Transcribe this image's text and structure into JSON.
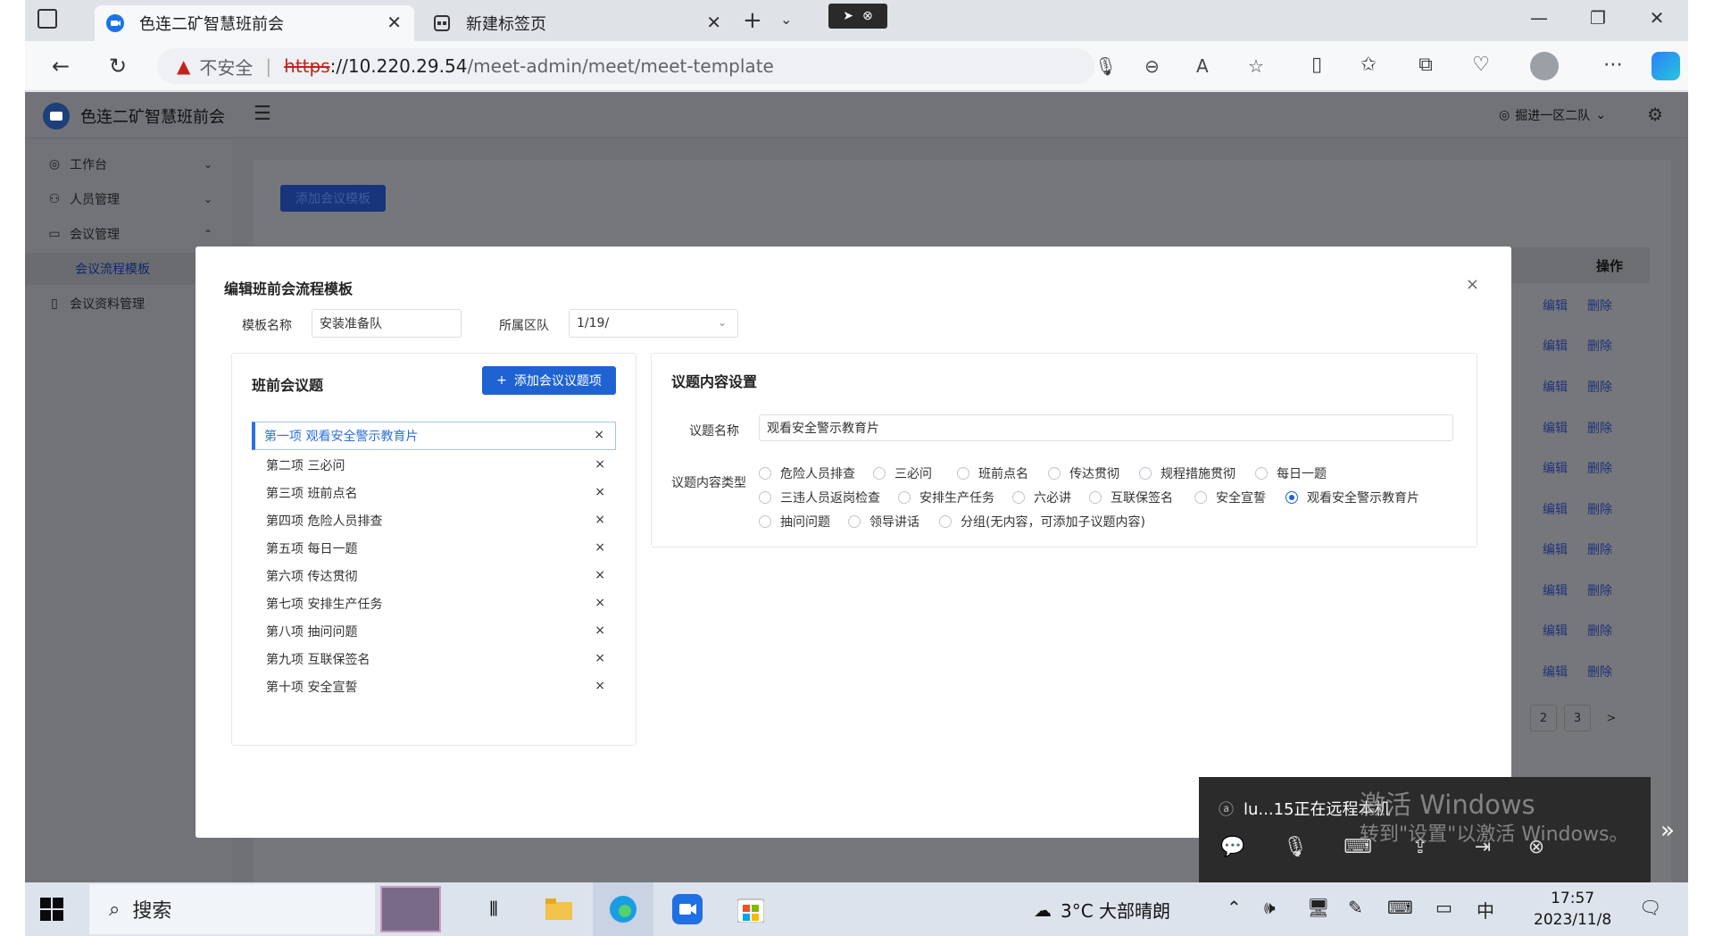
{
  "browser": {
    "tabs": [
      {
        "title": "色连二矿智慧班前会",
        "active": true
      },
      {
        "title": "新建标签页",
        "active": false
      }
    ],
    "url": {
      "insecure_label": "不安全",
      "scheme": "https",
      "host": "://10.220.29.54",
      "path": "/meet-admin/meet/meet-template"
    }
  },
  "app": {
    "title": "色连二矿智慧班前会",
    "team": "掘进一区二队",
    "sidebar": [
      {
        "label": "工作台"
      },
      {
        "label": "人员管理"
      },
      {
        "label": "会议管理"
      },
      {
        "label": "会议流程模板"
      },
      {
        "label": "会议资料管理"
      }
    ],
    "add_template_button": "添加会议模板",
    "table": {
      "ops_header": "操作",
      "edit_label": "编辑",
      "delete_label": "删除",
      "row_count": 10
    },
    "pager": [
      "2",
      "3",
      ">"
    ]
  },
  "modal": {
    "title": "编辑班前会流程模板",
    "close": "×",
    "template_name_label": "模板名称",
    "template_name_value": "安装准备队",
    "region_label": "所属区队",
    "region_value": "1/19/",
    "agenda_panel": {
      "title": "班前会议题",
      "add_button": "添加会议议题项",
      "items": [
        "第一项 观看安全警示教育片",
        "第二项 三必问",
        "第三项 班前点名",
        "第四项 危险人员排查",
        "第五项 每日一题",
        "第六项 传达贯彻",
        "第七项 安排生产任务",
        "第八项 抽问问题",
        "第九项 互联保签名",
        "第十项 安全宣誓"
      ],
      "selected_index": 0
    },
    "content_panel": {
      "title": "议题内容设置",
      "name_label": "议题名称",
      "name_value": "观看安全警示教育片",
      "type_label": "议题内容类型",
      "types": [
        "危险人员排查",
        "三必问",
        "班前点名",
        "传达贯彻",
        "规程措施贯彻",
        "每日一题",
        "三违人员返岗检查",
        "安排生产任务",
        "六必讲",
        "互联保签名",
        "安全宣誓",
        "观看安全警示教育片",
        "抽问问题",
        "领导讲话",
        "分组(无内容，可添加子议题内容)"
      ],
      "selected_type": "观看安全警示教育片"
    }
  },
  "remote": {
    "status": "lu...15正在远程本机",
    "watermark_title": "激活 Windows",
    "watermark_sub": "转到\"设置\"以激活 Windows。"
  },
  "taskbar": {
    "search_placeholder": "搜索",
    "weather": "3°C  大部晴朗",
    "ime": "中",
    "time": "17:57",
    "date": "2023/11/8"
  }
}
